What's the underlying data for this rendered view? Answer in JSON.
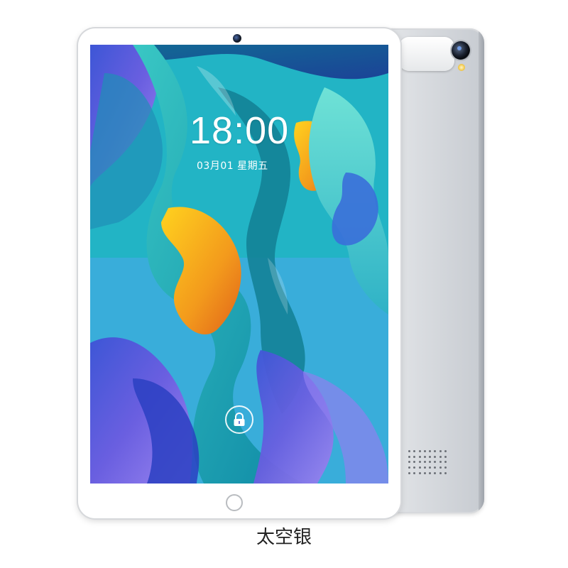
{
  "lockscreen": {
    "time": "18:00",
    "date": "03月01 星期五",
    "lock_icon": "lock-icon"
  },
  "product": {
    "color_name": "太空银"
  },
  "colors": {
    "body_silver": "#d9dce0",
    "screen_bezel": "#ffffff",
    "wallpaper_teal": "#1fb0c2",
    "wallpaper_orange": "#f6a21a",
    "wallpaper_purple": "#5a5ee0"
  },
  "icons": [
    "front-camera-icon",
    "rear-camera-icon",
    "flash-icon",
    "speaker-grille-icon",
    "home-button-icon",
    "lock-icon"
  ]
}
